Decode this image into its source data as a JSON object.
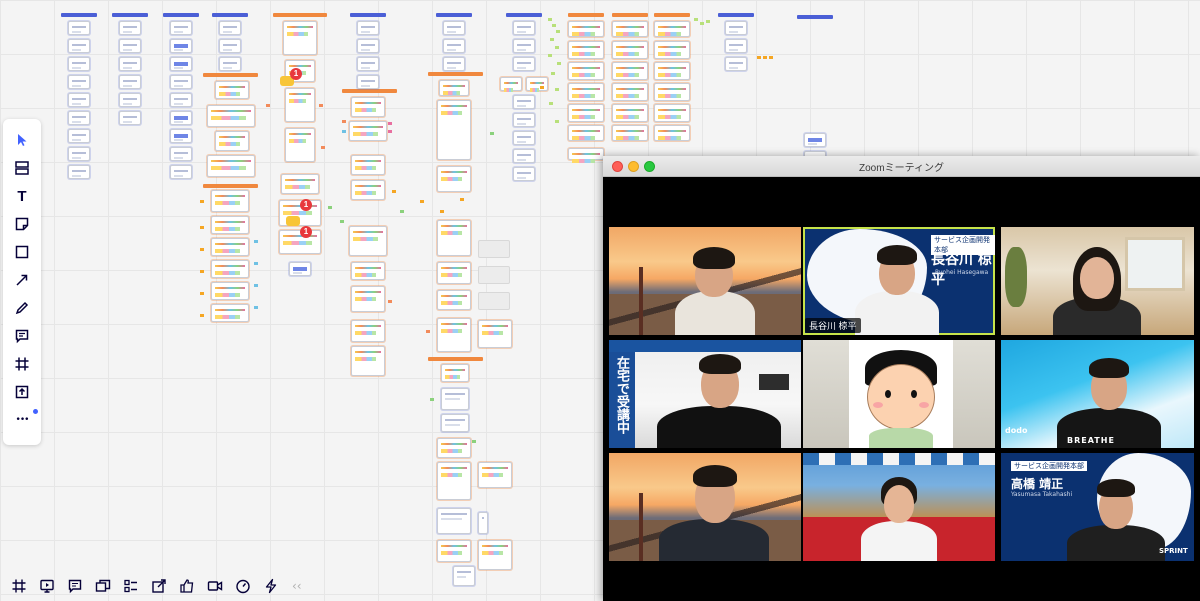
{
  "board": {
    "badges": [
      "1",
      "1",
      "1"
    ]
  },
  "toolbar": {
    "tools": [
      {
        "name": "select-tool",
        "icon": "cursor-icon"
      },
      {
        "name": "templates-tool",
        "icon": "layout-icon"
      },
      {
        "name": "text-tool",
        "icon": "text-icon"
      },
      {
        "name": "sticky-note-tool",
        "icon": "sticky-note-icon"
      },
      {
        "name": "shape-tool",
        "icon": "square-icon"
      },
      {
        "name": "connection-line-tool",
        "icon": "arrow-icon"
      },
      {
        "name": "pen-tool",
        "icon": "pen-icon"
      },
      {
        "name": "comment-tool",
        "icon": "comment-icon"
      },
      {
        "name": "frame-tool",
        "icon": "frame-icon"
      },
      {
        "name": "upload-tool",
        "icon": "upload-icon"
      },
      {
        "name": "more-tools",
        "icon": "more-icon"
      }
    ],
    "text_glyph": "T",
    "more_glyph": "•••"
  },
  "bottombar": {
    "collapse_glyph": "‹‹",
    "tools": [
      "frames-icon",
      "present-icon",
      "comments-icon",
      "cards-icon",
      "list-icon",
      "share-icon",
      "reactions-icon",
      "video-icon",
      "timer-icon",
      "integrations-icon"
    ]
  },
  "zoom": {
    "title": "Zoomミーティング",
    "participants": [
      {
        "id": "p1",
        "name_tag": "",
        "background": "sunset"
      },
      {
        "id": "p2",
        "name_tag": "長谷川 椋平",
        "background": "brand",
        "banner": "サービス企画開発本部",
        "display_name": "長谷川 椋平",
        "romaji": "Ryohei Hasegawa"
      },
      {
        "id": "p3",
        "name_tag": "",
        "background": "room"
      },
      {
        "id": "p4",
        "name_tag": "",
        "background": "study",
        "vertical_text": "在宅で受講中"
      },
      {
        "id": "p5",
        "name_tag": "",
        "background": "avatar"
      },
      {
        "id": "p6",
        "name_tag": "",
        "background": "cyan",
        "logo": "dodo",
        "shirt_text": "BREATHE"
      },
      {
        "id": "p7",
        "name_tag": "",
        "background": "sunset"
      },
      {
        "id": "p8",
        "name_tag": "",
        "background": "cafe"
      },
      {
        "id": "p9",
        "name_tag": "",
        "background": "brand",
        "banner": "サービス企画開発本部",
        "display_name": "高橋 靖正",
        "romaji": "Yasumasa Takahashi",
        "logo": "SPRINT"
      }
    ]
  }
}
